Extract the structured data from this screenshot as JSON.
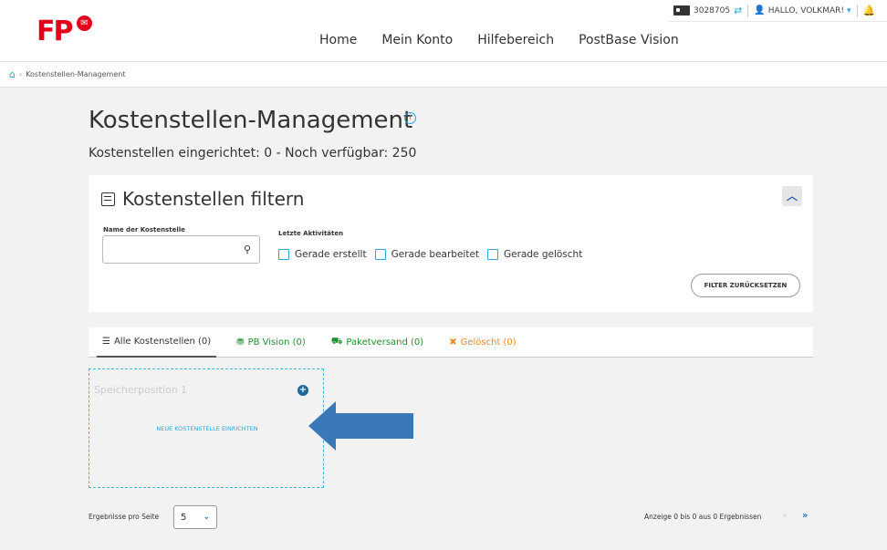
{
  "header": {
    "logo_text": "FP",
    "customer_id": "3028705",
    "greeting": "HALLO, VOLKMAR!",
    "nav": [
      "Home",
      "Mein Konto",
      "Hilfebereich",
      "PostBase Vision"
    ]
  },
  "breadcrumb": {
    "current": "Kostenstellen-Management"
  },
  "page": {
    "title": "Kostenstellen-Management",
    "subtitle": "Kostenstellen eingerichtet: 0 - Noch verfügbar: 250"
  },
  "filter": {
    "title": "Kostenstellen filtern",
    "name_label": "Name der Kostenstelle",
    "name_value": "",
    "activities_label": "Letzte Aktivitäten",
    "checkboxes": [
      "Gerade erstellt",
      "Gerade bearbeitet",
      "Gerade gelöscht"
    ],
    "reset_label": "FILTER ZURÜCKSETZEN"
  },
  "tabs": [
    {
      "label": "Alle Kostenstellen (0)",
      "color": "#333333"
    },
    {
      "label": "PB Vision (0)",
      "color": "#1e8f2e"
    },
    {
      "label": "Paketversand (0)",
      "color": "#1e8f2e"
    },
    {
      "label": "Gelöscht (0)",
      "color": "#f08a24"
    }
  ],
  "slot": {
    "title": "Speicherposition 1",
    "action": "NEUE KOSTENSTELLE EINRICHTEN"
  },
  "footer": {
    "results_label": "Ergebnisse pro Seite",
    "per_page": "5",
    "paging_info": "Anzeige 0 bis 0 aus 0 Ergebnissen"
  },
  "colors": {
    "brand": "#e2001a",
    "accent": "#2aa7d8",
    "primary": "#2a6db5",
    "annotation_arrow": "#3b78b8"
  }
}
